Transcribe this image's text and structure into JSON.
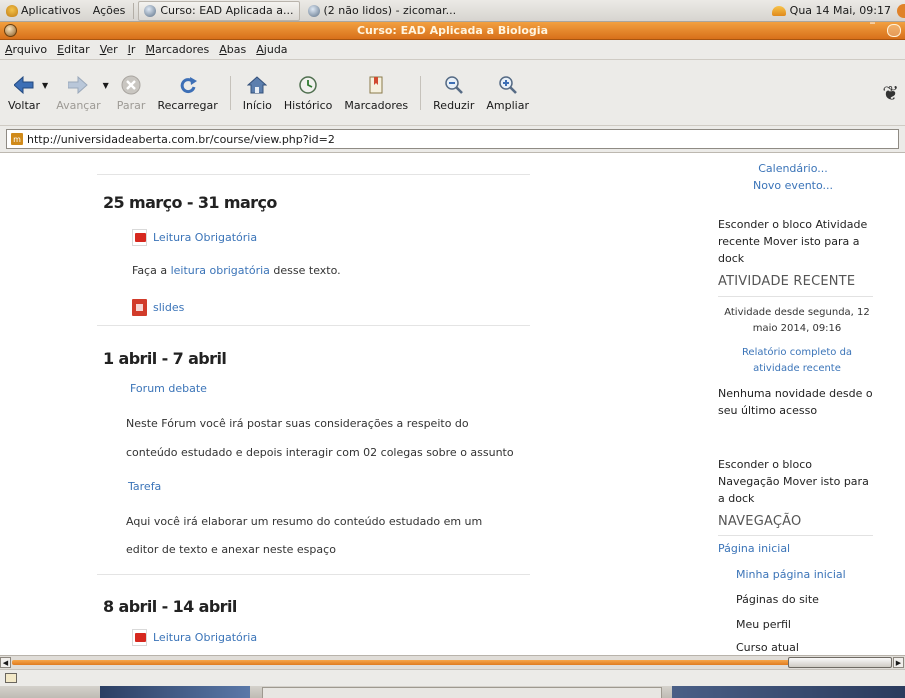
{
  "gnome_panel": {
    "apps_label": "Aplicativos",
    "actions_label": "Ações",
    "tasks": [
      {
        "label": "Curso: EAD Aplicada a...",
        "active": true
      },
      {
        "label": "(2 não lidos) - zicomar...",
        "active": false
      }
    ],
    "clock": "Qua 14 Mai, 09:17"
  },
  "window": {
    "title": "Curso: EAD Aplicada a Biologia"
  },
  "menubar": {
    "items": [
      "Arquivo",
      "Editar",
      "Ver",
      "Ir",
      "Marcadores",
      "Abas",
      "Ajuda"
    ]
  },
  "toolbar": {
    "back": "Voltar",
    "forward": "Avançar",
    "stop": "Parar",
    "reload": "Recarregar",
    "home": "Início",
    "history": "Histórico",
    "bookmarks": "Marcadores",
    "zoom_out": "Reduzir",
    "zoom_in": "Ampliar"
  },
  "location": {
    "url": "http://universidadeaberta.com.br/course/view.php?id=2"
  },
  "course": {
    "sections": [
      {
        "title": "25 março - 31 março",
        "resource1": "Leitura Obrigatória",
        "text_prefix": "Faça a ",
        "text_link": "leitura obrigatória",
        "text_suffix": " desse texto.",
        "resource2": "slides"
      },
      {
        "title": "1 abril - 7 abril",
        "forum": "Forum debate",
        "forum_text1": "Neste Fórum você irá postar suas considerações a respeito do",
        "forum_text2": "conteúdo estudado e depois interagir com 02 colegas sobre o assunto",
        "task": "Tarefa",
        "task_text1": "Aqui você irá elaborar um resumo do conteúdo estudado em um",
        "task_text2": "editor de texto e anexar  neste espaço"
      },
      {
        "title": "8 abril - 14 abril",
        "resource1": "Leitura Obrigatória"
      }
    ]
  },
  "sidebar": {
    "calendar_link": "Calendário...",
    "new_event_link": "Novo evento...",
    "recent_hide_text": "Esconder o bloco Atividade recente Mover isto para a dock",
    "recent_title": "ATIVIDADE RECENTE",
    "recent_since": "Atividade desde segunda, 12 maio 2014, 09:16",
    "recent_full_report": "Relatório completo da atividade recente",
    "recent_none": "Nenhuma novidade desde o seu último acesso",
    "nav_hide_text": "Esconder o bloco Navegação Mover isto para a dock",
    "nav_title": "NAVEGAÇÃO",
    "nav_home": "Página inicial",
    "nav_my_home": "Minha página inicial",
    "nav_site_pages": "Páginas do site",
    "nav_profile": "Meu perfil",
    "nav_current_course": "Curso atual"
  },
  "colors": {
    "titlebar": "#e0822a",
    "link": "#3b74b8"
  }
}
